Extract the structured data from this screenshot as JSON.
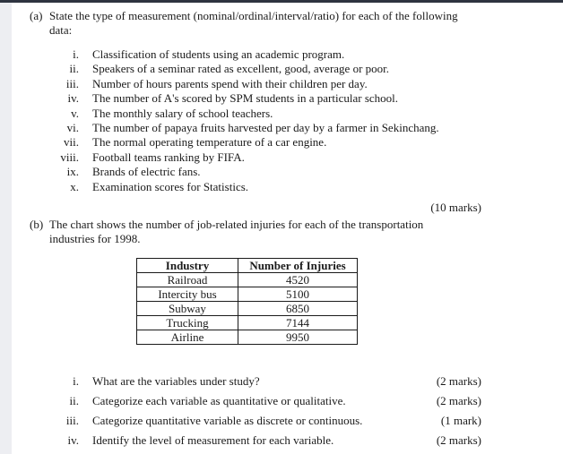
{
  "document": {
    "part_a": {
      "label": "(a)",
      "text_line1": "State the type of measurement (nominal/ordinal/interval/ratio) for each of the following",
      "text_line2": "data:",
      "items": [
        {
          "numeral": "i.",
          "text": "Classification of students using an academic program."
        },
        {
          "numeral": "ii.",
          "text": "Speakers of a seminar rated as excellent, good, average or poor."
        },
        {
          "numeral": "iii.",
          "text": "Number of hours parents spend with their children per day."
        },
        {
          "numeral": "iv.",
          "text": "The number of A's scored by SPM students in a particular school."
        },
        {
          "numeral": "v.",
          "text": "The monthly salary of school teachers."
        },
        {
          "numeral": "vi.",
          "text": "The number of papaya fruits harvested per day by a farmer in Sekinchang."
        },
        {
          "numeral": "vii.",
          "text": "The normal operating temperature of a car engine."
        },
        {
          "numeral": "viii.",
          "text": "Football teams ranking by FIFA."
        },
        {
          "numeral": "ix.",
          "text": "Brands of electric fans."
        },
        {
          "numeral": "x.",
          "text": "Examination scores for Statistics."
        }
      ],
      "marks": "(10 marks)"
    },
    "part_b": {
      "label": "(b)",
      "text_line1": "The chart shows the number of job-related injuries for each of the transportation",
      "text_line2": "industries for 1998.",
      "table": {
        "headers": [
          "Industry",
          "Number of Injuries"
        ],
        "rows": [
          [
            "Railroad",
            "4520"
          ],
          [
            "Intercity bus",
            "5100"
          ],
          [
            "Subway",
            "6850"
          ],
          [
            "Trucking",
            "7144"
          ],
          [
            "Airline",
            "9950"
          ]
        ]
      },
      "items": [
        {
          "numeral": "i.",
          "text": "What are the variables under study?",
          "marks": "(2 marks)"
        },
        {
          "numeral": "ii.",
          "text": "Categorize each variable as quantitative or qualitative.",
          "marks": "(2 marks)"
        },
        {
          "numeral": "iii.",
          "text": "Categorize quantitative variable as discrete or continuous.",
          "marks": "(1  mark)"
        },
        {
          "numeral": "iv.",
          "text": "Identify the level of measurement for each variable.",
          "marks": "(2 marks)"
        }
      ]
    }
  }
}
